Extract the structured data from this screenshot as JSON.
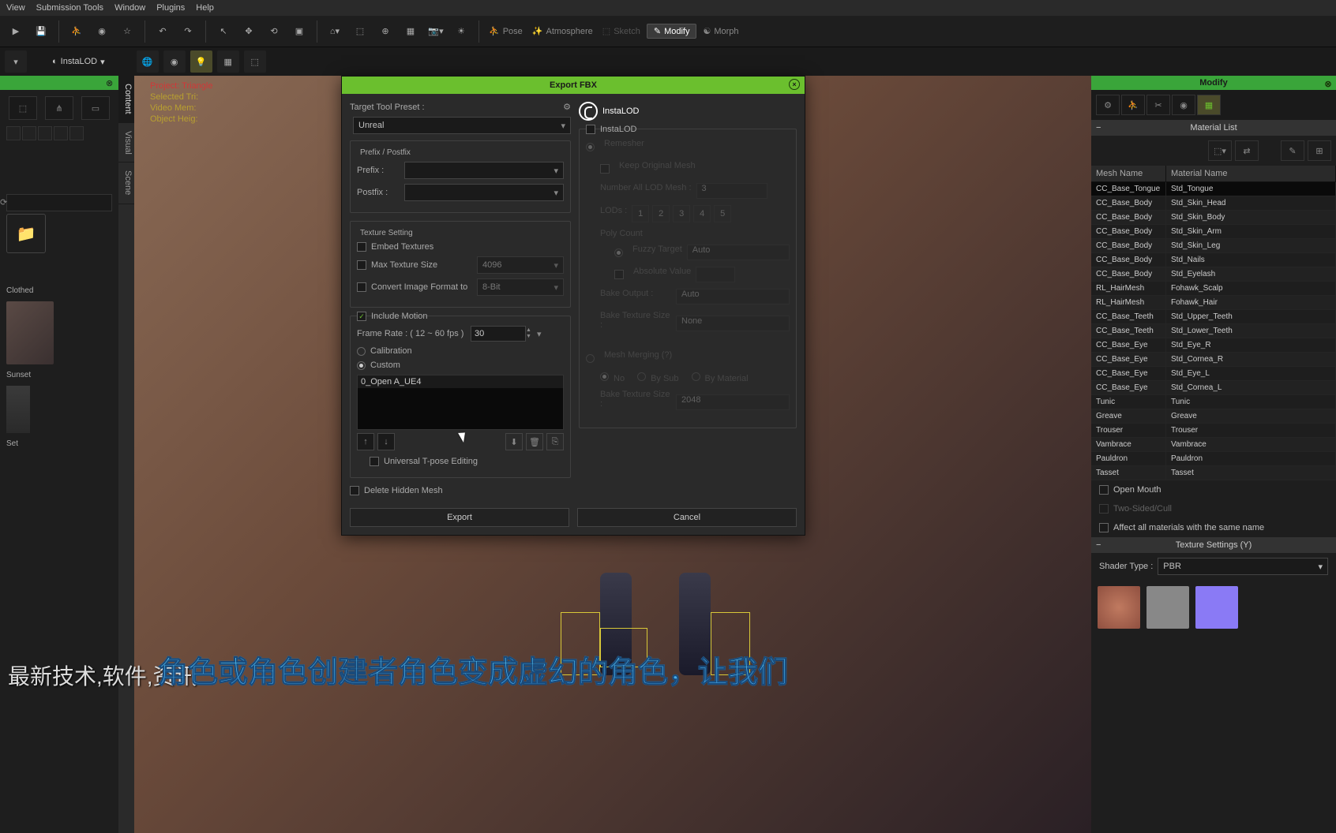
{
  "menu": {
    "view": "View",
    "submission": "Submission Tools",
    "window": "Window",
    "plugins": "Plugins",
    "help": "Help"
  },
  "toolbar": {
    "pose": "Pose",
    "atmosphere": "Atmosphere",
    "sketch": "Sketch",
    "modify": "Modify",
    "morph": "Morph"
  },
  "subtoolbar": {
    "instalod": "InstaLOD"
  },
  "viewport_info": {
    "l1": "Project: Triangle",
    "l2": "Selected Tri:",
    "l3": "Video Mem:",
    "l4": "Object Heig:"
  },
  "dialog": {
    "title": "Export FBX",
    "target_preset_label": "Target Tool Preset :",
    "preset_value": "Unreal",
    "prefix_postfix": "Prefix / Postfix",
    "prefix": "Prefix :",
    "postfix": "Postfix :",
    "texture_setting": "Texture Setting",
    "embed": "Embed Textures",
    "max_tex": "Max Texture Size",
    "convert": "Convert Image Format to",
    "max_val": "4096",
    "convert_val": "8-Bit",
    "include_motion": "Include Motion",
    "frame_rate": "Frame Rate : ( 12 ~ 60 fps )",
    "frame_val": "30",
    "calibration": "Calibration",
    "custom": "Custom",
    "motion_item": "0_Open A_UE4",
    "tpose": "Universal T-pose Editing",
    "delete_hidden": "Delete Hidden Mesh",
    "export": "Export",
    "cancel": "Cancel",
    "instalod_chk": "InstaLOD",
    "remesher": "Remesher",
    "keep_orig": "Keep Original Mesh",
    "num_lod": "Number All LOD Mesh :",
    "lod_val": "3",
    "lods": "LODs :",
    "poly_count": "Poly Count",
    "fuzzy": "Fuzzy Target",
    "fuzzy_val": "Auto",
    "abs": "Absolute Value",
    "bake_output": "Bake Output :",
    "bake_val": "Auto",
    "bake_tex": "Bake Texture Size :",
    "bake_tex_val": "None",
    "mesh_merge": "Mesh Merging (?)",
    "mm_no": "No",
    "mm_sub": "By Sub",
    "mm_mat": "By Material",
    "bake_tex2": "Bake Texture Size :",
    "bake_tex2_val": "2048"
  },
  "right": {
    "title": "Modify",
    "material_list": "Material List",
    "mesh_name": "Mesh Name",
    "material_name": "Material Name",
    "rows": [
      {
        "m": "CC_Base_Tongue",
        "n": "Std_Tongue"
      },
      {
        "m": "CC_Base_Body",
        "n": "Std_Skin_Head"
      },
      {
        "m": "CC_Base_Body",
        "n": "Std_Skin_Body"
      },
      {
        "m": "CC_Base_Body",
        "n": "Std_Skin_Arm"
      },
      {
        "m": "CC_Base_Body",
        "n": "Std_Skin_Leg"
      },
      {
        "m": "CC_Base_Body",
        "n": "Std_Nails"
      },
      {
        "m": "CC_Base_Body",
        "n": "Std_Eyelash"
      },
      {
        "m": "RL_HairMesh",
        "n": "Fohawk_Scalp"
      },
      {
        "m": "RL_HairMesh",
        "n": "Fohawk_Hair"
      },
      {
        "m": "CC_Base_Teeth",
        "n": "Std_Upper_Teeth"
      },
      {
        "m": "CC_Base_Teeth",
        "n": "Std_Lower_Teeth"
      },
      {
        "m": "CC_Base_Eye",
        "n": "Std_Eye_R"
      },
      {
        "m": "CC_Base_Eye",
        "n": "Std_Cornea_R"
      },
      {
        "m": "CC_Base_Eye",
        "n": "Std_Eye_L"
      },
      {
        "m": "CC_Base_Eye",
        "n": "Std_Cornea_L"
      },
      {
        "m": "Tunic",
        "n": "Tunic"
      },
      {
        "m": "Greave",
        "n": "Greave"
      },
      {
        "m": "Trouser",
        "n": "Trouser"
      },
      {
        "m": "Vambrace",
        "n": "Vambrace"
      },
      {
        "m": "Pauldron",
        "n": "Pauldron"
      },
      {
        "m": "Tasset",
        "n": "Tasset"
      }
    ],
    "open_mouth": "Open Mouth",
    "two_sided": "Two-Sided/Cull",
    "affect_all": "Affect all materials with the same name",
    "texture_settings": "Texture Settings  (Y)",
    "shader_type": "Shader Type :",
    "shader_val": "PBR"
  },
  "sidetabs": {
    "content": "Content",
    "visual": "Visual",
    "scene": "Scene"
  },
  "left": {
    "clothed": "Clothed",
    "sunset": "Sunset",
    "set": "Set"
  },
  "subtitle_bg": "最新技术,软件,资讯",
  "subtitle_fg": "角色或角色创建者角色变成虚幻的角色，让我们"
}
